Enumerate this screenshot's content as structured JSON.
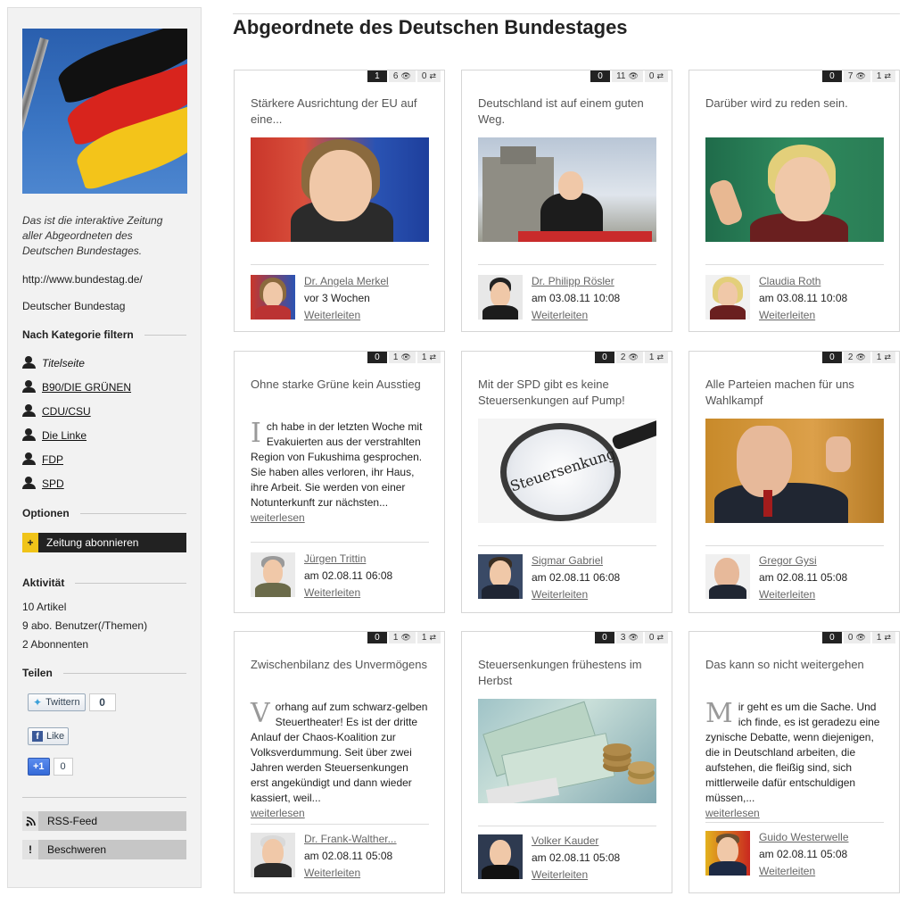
{
  "sidebar": {
    "description": "Das ist die interaktive Zeitung aller Abgeordneten des Deutschen Bundestages.",
    "url": "http://www.bundestag.de/",
    "name": "Deutscher Bundestag",
    "filter_heading": "Nach Kategorie filtern",
    "categories": [
      {
        "label": "Titelseite",
        "icon": "person-icon"
      },
      {
        "label": "B90/DIE GRÜNEN",
        "icon": "person-icon"
      },
      {
        "label": "CDU/CSU",
        "icon": "person-icon"
      },
      {
        "label": "Die Linke",
        "icon": "person-icon"
      },
      {
        "label": "FDP",
        "icon": "person-icon"
      },
      {
        "label": "SPD",
        "icon": "person-icon"
      }
    ],
    "options_heading": "Optionen",
    "subscribe_label": "Zeitung abonnieren",
    "subscribe_icon": "+",
    "activity_heading": "Aktivität",
    "activity": [
      "10 Artikel",
      "9 abo. Benutzer(/Themen)",
      "2 Abonnenten"
    ],
    "share_heading": "Teilen",
    "twitter_label": "Twittern",
    "twitter_count": "0",
    "facebook_label": "Like",
    "gplus_label": "+1",
    "gplus_count": "0",
    "rss_label": "RSS-Feed",
    "complain_label": "Beschweren",
    "complain_icon": "!"
  },
  "page_title": "Abgeordnete des Deutschen Bundestages",
  "cards": [
    {
      "stats": [
        "1",
        "6",
        "0"
      ],
      "title": "Stärkere Ausrichtung der EU auf eine...",
      "author": "Dr. Angela Merkel",
      "time": "vor 3 Wochen",
      "forward": "Weiterleiten"
    },
    {
      "stats": [
        "0",
        "11",
        "0"
      ],
      "title": "Deutschland ist auf einem guten Weg.",
      "author": "Dr. Philipp Rösler",
      "time": "am 03.08.11 10:08",
      "forward": "Weiterleiten"
    },
    {
      "stats": [
        "0",
        "7",
        "1"
      ],
      "title": "Darüber wird zu reden sein.",
      "author": "Claudia Roth",
      "time": "am 03.08.11 10:08",
      "forward": "Weiterleiten"
    },
    {
      "stats": [
        "0",
        "1",
        "1"
      ],
      "title": "Ohne starke Grüne kein Ausstieg",
      "dropcap": "I",
      "excerpt": "ch habe in der letzten Woche mit Evakuierten aus der verstrahlten Region von Fukushima gesprochen. Sie haben alles verloren, ihr Haus, ihre Arbeit. Sie werden von einer Notunterkunft zur nächsten...",
      "readmore": "weiterlesen",
      "author": "Jürgen Trittin",
      "time": "am 02.08.11 06:08",
      "forward": "Weiterleiten"
    },
    {
      "stats": [
        "0",
        "2",
        "1"
      ],
      "title": "Mit der SPD gibt es keine Steuersenkungen auf Pump!",
      "img_text": "Steuersenkung",
      "author": "Sigmar Gabriel",
      "time": "am 02.08.11 06:08",
      "forward": "Weiterleiten"
    },
    {
      "stats": [
        "0",
        "2",
        "1"
      ],
      "title": "Alle Parteien machen für uns Wahlkampf",
      "author": "Gregor Gysi",
      "time": "am 02.08.11 05:08",
      "forward": "Weiterleiten"
    },
    {
      "stats": [
        "0",
        "1",
        "1"
      ],
      "title": "Zwischenbilanz des Unvermögens",
      "dropcap": "V",
      "excerpt": "orhang auf zum schwarz-gelben Steuertheater! Es ist der dritte Anlauf der Chaos-Koalition zur Volksverdummung. Seit über zwei Jahren werden Steuersenkungen erst angekündigt und dann wieder kassiert, weil...",
      "readmore": "weiterlesen",
      "author": "Dr. Frank-Walther...",
      "time": "am 02.08.11 05:08",
      "forward": "Weiterleiten"
    },
    {
      "stats": [
        "0",
        "3",
        "0"
      ],
      "title": "Steuersenkungen frühestens im Herbst",
      "author": "Volker Kauder",
      "time": "am 02.08.11 05:08",
      "forward": "Weiterleiten"
    },
    {
      "stats": [
        "0",
        "0",
        "1"
      ],
      "title": "Das kann so nicht weitergehen",
      "dropcap": "M",
      "excerpt": "ir geht es um die Sache. Und ich finde, es ist geradezu eine zynische Debatte, wenn diejenigen, die in Deutschland arbeiten, die aufstehen, die fleißig sind, sich mittlerweile dafür entschuldigen müssen,...",
      "readmore": "weiterlesen",
      "author": "Guido Westerwelle",
      "time": "am 02.08.11 05:08",
      "forward": "Weiterleiten"
    }
  ],
  "stat_icons": [
    "comments-icon",
    "views-icon",
    "shares-icon"
  ]
}
